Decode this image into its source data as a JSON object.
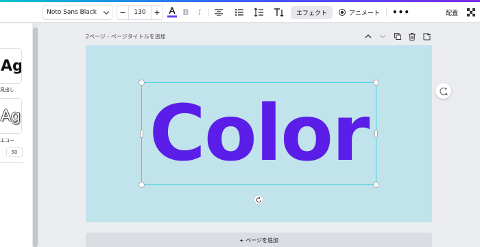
{
  "toolbar": {
    "font_name": "Noto Sans Black",
    "font_size": "130",
    "decrease": "−",
    "increase": "+",
    "effect_label": "エフェクト",
    "animate_label": "アニメート",
    "more_label": "•••",
    "arrange_label": "配置"
  },
  "side_panel": {
    "card1_text": "Ag",
    "card1_label": "見出し",
    "card2_text": "Ag",
    "card2_label": "エコー",
    "value": "50"
  },
  "page": {
    "title": "2ページ - ページタイトルを追加"
  },
  "canvas": {
    "text": "Color",
    "background_color": "#c1e3eb",
    "text_color": "#5a1ee8"
  },
  "add_page_label": "+ ページを追加"
}
